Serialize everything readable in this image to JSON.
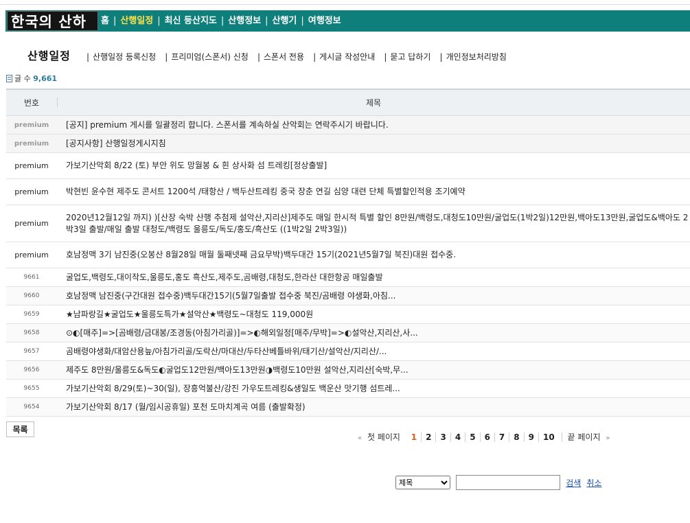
{
  "header": {
    "logo_text": "한국의 산하",
    "menu": [
      {
        "label": "홈",
        "active": false
      },
      {
        "label": "산행일정",
        "active": true
      },
      {
        "label": "최신 등산지도",
        "active": false
      },
      {
        "label": "산행정보",
        "active": false
      },
      {
        "label": "산행기",
        "active": false
      },
      {
        "label": "여행정보",
        "active": false
      }
    ],
    "colors": {
      "bar": "#0e7f7a",
      "active": "#ffe14a"
    }
  },
  "subnav": {
    "title": "산행일정",
    "links": [
      "산행일정 등록신청",
      "프리미엄(스폰서) 신청",
      "스폰서 전용",
      "게시글 작성안내",
      "묻고 답하기",
      "개인정보처리방침"
    ]
  },
  "count": {
    "label": "글 수",
    "value": "9,661"
  },
  "table": {
    "headers": {
      "no": "번호",
      "subject": "제목"
    },
    "rows": [
      {
        "type": "notice",
        "no": "premium",
        "subject": "[공지] premium 게시를 일괄정리 합니다. 스폰서를 계속하실 산악회는 연락주시기 바랍니다."
      },
      {
        "type": "notice",
        "no": "premium",
        "subject": "[공지사항] 산행일정게시지침"
      },
      {
        "type": "prem",
        "no": "premium",
        "subject": "가보기산악회 8/22 (토) 부안 위도 망월봉 & 흰 상사화 섬 트레킹[정상출발]"
      },
      {
        "type": "prem",
        "no": "premium",
        "subject": "박현빈 윤수현 제주도 콘서트 1200석 /태항산 / 백두산트레킹 중국 장춘 연길 심양 대련 단체 특별할인적용 조기예약"
      },
      {
        "type": "prem tall",
        "no": "premium",
        "subject": "2020년12월12일 까지) )[산장 숙박 산행 추첨제 설악산,지리산]제주도 매일 한시적 특별 할인 8만원/백령도,대청도10만원/굴업도(1박2일)12만원,백아도13만원,굴업도&백아도 2박3일 출발/매일 출발 대청도/백령도 울릉도/독도/홍도/흑산도 ((1박2일 2박3일))"
      },
      {
        "type": "prem",
        "no": "premium",
        "subject": "호남정맥 3기 남진중(오봉산 8월28일 매월 둘째넷째 금요무박)백두대간 15기(2021년5월7일 북진)대원 접수중."
      },
      {
        "type": "norm",
        "no": "9661",
        "subject": "굴업도,백령도,대이작도,울릉도,홍도 흑산도,제주도,곰배령,대청도,한라산 대한항공 매일출발"
      },
      {
        "type": "norm",
        "no": "9660",
        "subject": "호남정맥 남진중(구간대원 접수중)백두대간15기(5월7일출발 접수중 북진/곰배령 야생화,아침..."
      },
      {
        "type": "norm",
        "no": "9659",
        "subject": "★남파랑길★굴업도★울릉도특가★설악산★백령도~대청도 119,000원"
      },
      {
        "type": "norm",
        "no": "9658",
        "subject": "⊙◐[매주]=>[곰배령/금대봉/조경동(아침가리골)]=>◐해외일정[매주/무박]=>◐설악산,지리산,사..."
      },
      {
        "type": "norm",
        "no": "9657",
        "subject": "곰배령야생화/대암산용늪/아침가리골/도락산/마대산/두타산베틀바위/태기산/설악산/지리산/..."
      },
      {
        "type": "norm",
        "no": "9656",
        "subject": "제주도 8만원/울릉도&독도◐굴업도12만원/백아도13만원◑백령도10만원 설악산,지리산[숙박,무..."
      },
      {
        "type": "norm",
        "no": "9655",
        "subject": "가보기산악회 8/29(토)~30(일), 장흥억불산/강진 가우도트레킹&생일도 백운산 맛기행 섬트레..."
      },
      {
        "type": "norm",
        "no": "9654",
        "subject": "가보기산악회 8/17 (월/임시공휴일) 포천 도마치계곡 여름 (출발확정)"
      }
    ]
  },
  "list_button": "목록",
  "pager": {
    "first": "첫 페이지",
    "last": "끝 페이지",
    "pages": [
      "1",
      "2",
      "3",
      "4",
      "5",
      "6",
      "7",
      "8",
      "9",
      "10"
    ],
    "current": "1",
    "prev_arrow": "«",
    "next_arrow": "»"
  },
  "search": {
    "selected": "제목",
    "search_label": "검색",
    "cancel_label": "취소"
  }
}
